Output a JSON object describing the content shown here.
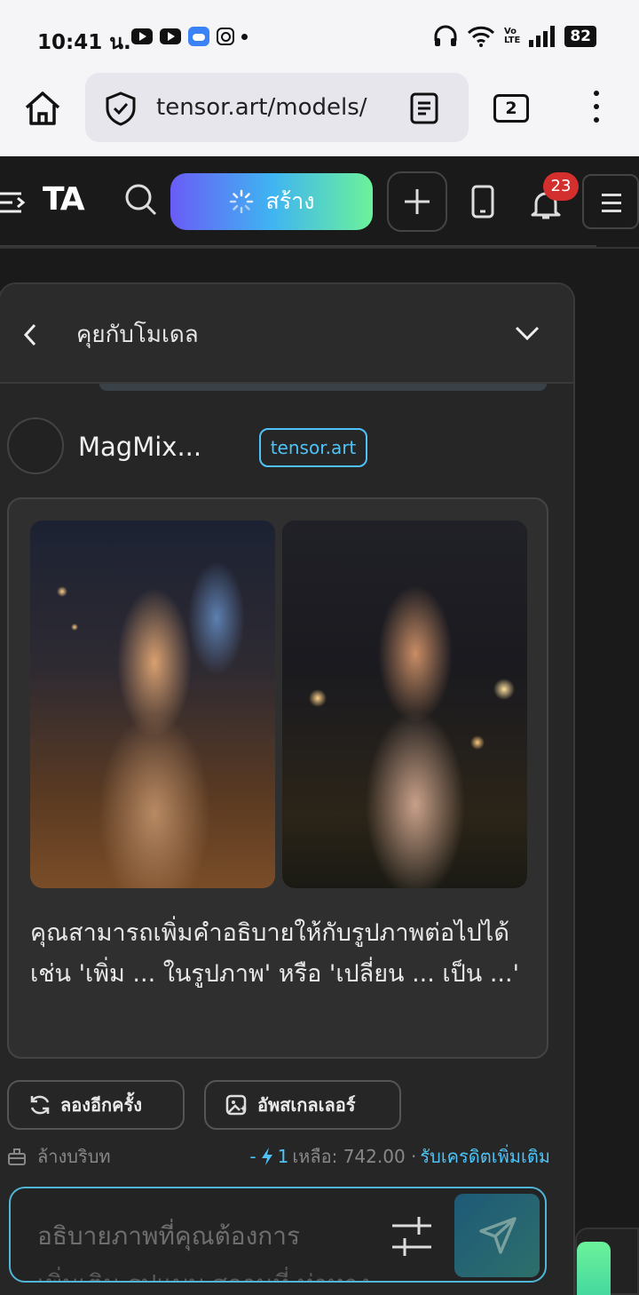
{
  "status_bar": {
    "time": "10:41 น.",
    "battery": "82",
    "volte": "Vo\nLTE"
  },
  "browser": {
    "url": "tensor.art/models/",
    "tab_count": "2"
  },
  "header": {
    "logo": "TA",
    "create_label": "สร้าง",
    "notification_count": "23"
  },
  "chat": {
    "title": "คุยกับโมเดล",
    "model_name": "MagMix...",
    "model_tag": "tensor.art",
    "message": "คุณสามารถเพิ่มคำอธิบายให้กับรูปภาพต่อไปได้ เช่น 'เพิ่ม ... ในรูปภาพ' หรือ 'เปลี่ยน ... เป็น ...'",
    "retry_label": "ลองอีกครั้ง",
    "upscale_label": "อัพสเกลเลอร์",
    "clear_label": "ล้างบริบท",
    "cost": "-",
    "cost_value": "1",
    "balance": "เหลือ: 742.00 ·",
    "get_credits": "รับเครดิตเพิ่มเติม",
    "input_placeholder": "อธิบายภาพที่คุณต้องการ",
    "input_placeholder_more": "เพิ่มเติม รูปแบบ สถานที่ ท่าทาง"
  }
}
